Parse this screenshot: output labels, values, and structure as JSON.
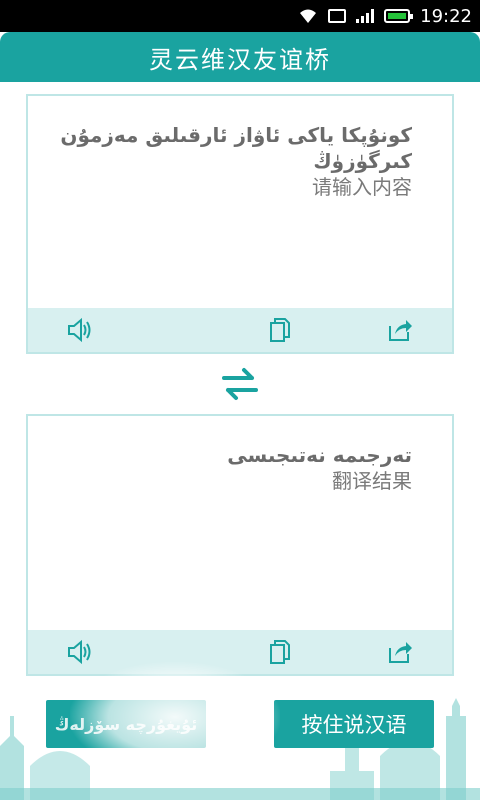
{
  "status_bar": {
    "time": "19:22"
  },
  "header": {
    "title": "灵云维汉友谊桥"
  },
  "input_panel": {
    "uyghur_line1": "كونۇپكا ياكى ئاۋاز ئارقىلىق مەزمۇن",
    "uyghur_line2": "كىرگۈزۈڭ",
    "placeholder": "请输入内容",
    "toolbar": {
      "speak_icon": "speaker-icon",
      "copy_icon": "copy-icon",
      "share_icon": "share-icon"
    }
  },
  "swap": {
    "icon": "swap-arrows-icon"
  },
  "output_panel": {
    "uyghur_label": "تەرجىمە نەتىجىسى",
    "label": "翻译结果",
    "toolbar": {
      "speak_icon": "speaker-icon",
      "copy_icon": "copy-icon",
      "share_icon": "share-icon"
    }
  },
  "buttons": {
    "uyghur_speak_label": "ئۇيغۇرچە سۆزلەڭ",
    "mandarin_speak_label": "按住说汉语"
  },
  "colors": {
    "accent": "#1aa3a0",
    "toolbar_bg": "#d8f0f0",
    "panel_border": "#bfe6e6",
    "text_gray": "#6b6b6b"
  }
}
